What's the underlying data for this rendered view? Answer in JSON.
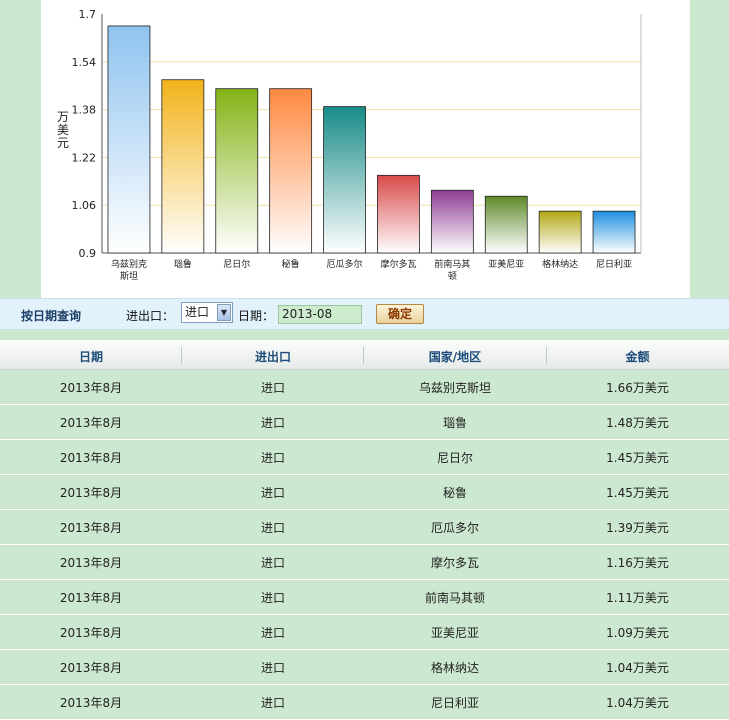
{
  "chart_data": {
    "type": "bar",
    "categories": [
      "乌兹别克斯坦",
      "瑙鲁",
      "尼日尔",
      "秘鲁",
      "厄瓜多尔",
      "摩尔多瓦",
      "前南马其顿",
      "亚美尼亚",
      "格林纳达",
      "尼日利亚"
    ],
    "category_display": [
      [
        "乌兹别克",
        "斯坦"
      ],
      [
        "瑙鲁"
      ],
      [
        "尼日尔"
      ],
      [
        "秘鲁"
      ],
      [
        "厄瓜多尔"
      ],
      [
        "摩尔多瓦"
      ],
      [
        "前南马其",
        "顿"
      ],
      [
        "亚美尼亚"
      ],
      [
        "格林纳达"
      ],
      [
        "尼日利亚"
      ]
    ],
    "values": [
      1.66,
      1.48,
      1.45,
      1.45,
      1.39,
      1.16,
      1.11,
      1.09,
      1.04,
      1.04
    ],
    "ylabel": "万美元",
    "ylim": [
      0.9,
      1.7
    ],
    "yticks": [
      "1.7",
      "1.54",
      "1.38",
      "1.22",
      "1.06",
      "0.9"
    ],
    "grid": true,
    "colors": [
      "#8ec3ef",
      "#f2b31a",
      "#85b316",
      "#ff8840",
      "#178b87",
      "#d94a4a",
      "#8f3d93",
      "#5f8a2a",
      "#b2a813",
      "#1e8fe0"
    ]
  },
  "query": {
    "title": "按日期查询",
    "direction_label": "进出口：",
    "direction_value": "进口",
    "date_label": "日期：",
    "date_value": "2013-08",
    "confirm_label": "确定"
  },
  "table": {
    "columns": [
      "日期",
      "进出口",
      "国家/地区",
      "金额"
    ],
    "rows": [
      [
        "2013年8月",
        "进口",
        "乌兹别克斯坦",
        "1.66万美元"
      ],
      [
        "2013年8月",
        "进口",
        "瑙鲁",
        "1.48万美元"
      ],
      [
        "2013年8月",
        "进口",
        "尼日尔",
        "1.45万美元"
      ],
      [
        "2013年8月",
        "进口",
        "秘鲁",
        "1.45万美元"
      ],
      [
        "2013年8月",
        "进口",
        "厄瓜多尔",
        "1.39万美元"
      ],
      [
        "2013年8月",
        "进口",
        "摩尔多瓦",
        "1.16万美元"
      ],
      [
        "2013年8月",
        "进口",
        "前南马其顿",
        "1.11万美元"
      ],
      [
        "2013年8月",
        "进口",
        "亚美尼亚",
        "1.09万美元"
      ],
      [
        "2013年8月",
        "进口",
        "格林纳达",
        "1.04万美元"
      ],
      [
        "2013年8月",
        "进口",
        "尼日利亚",
        "1.04万美元"
      ]
    ]
  }
}
